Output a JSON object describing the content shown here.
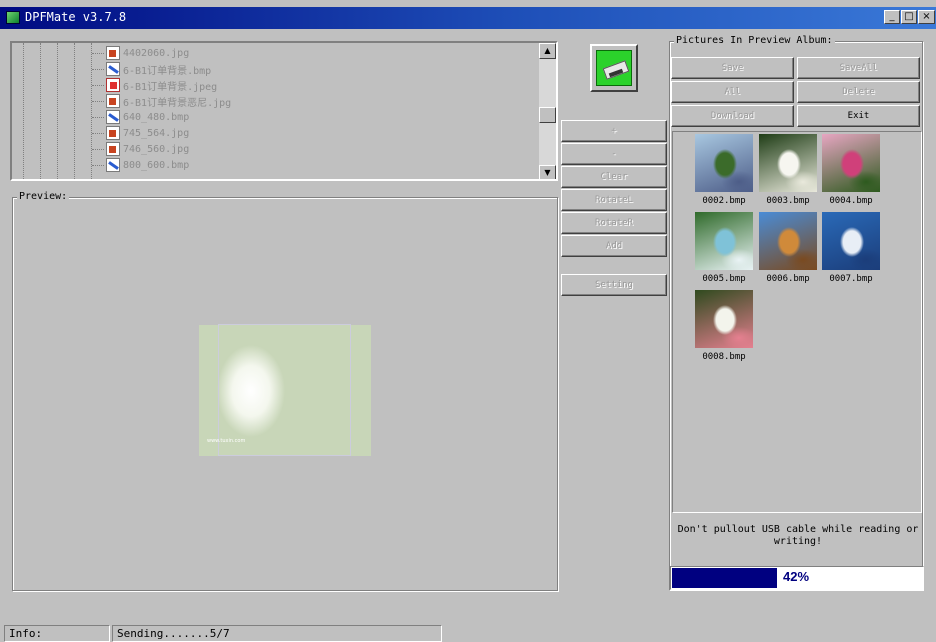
{
  "window": {
    "title": "DPFMate v3.7.8",
    "min_glyph": "_",
    "max_glyph": "□",
    "close_glyph": "×"
  },
  "file_tree": {
    "items": [
      {
        "name": "4402060.jpg",
        "type": "jpg"
      },
      {
        "name": "6-B1订单背景.bmp",
        "type": "bmp"
      },
      {
        "name": "6-B1订单背景.jpeg",
        "type": "jpeg"
      },
      {
        "name": "6-B1订单背景恶尼.jpg",
        "type": "jpg"
      },
      {
        "name": "640_480.bmp",
        "type": "bmp"
      },
      {
        "name": "745_564.jpg",
        "type": "jpg"
      },
      {
        "name": "746_560.jpg",
        "type": "jpg"
      },
      {
        "name": "800_600.bmp",
        "type": "bmp"
      }
    ]
  },
  "preview": {
    "title": "Preview:",
    "watermark": "www.tuxin.com"
  },
  "controls": {
    "zoom_in_label": "+",
    "zoom_out_label": "-",
    "clear_label": "Clear",
    "rotate_left_label": "RotateL",
    "rotate_right_label": "RotateR",
    "add_label": "Add",
    "setting_label": "Setting"
  },
  "album": {
    "title": "Pictures In Preview Album:",
    "save_label": "Save",
    "save_all_label": "SaveAll",
    "all_label": "All",
    "delete_label": "Delete",
    "download_label": "Download",
    "exit_label": "Exit",
    "thumbnails": [
      {
        "name": "0002.bmp",
        "colors": [
          "#a8c7e0",
          "#3b6b2a",
          "#4d5d88"
        ]
      },
      {
        "name": "0003.bmp",
        "colors": [
          "#1f3d16",
          "#f6f6f0",
          "#e9e9dc"
        ]
      },
      {
        "name": "0004.bmp",
        "colors": [
          "#e7a6c2",
          "#d0407a",
          "#2d5a1e"
        ]
      },
      {
        "name": "0005.bmp",
        "colors": [
          "#2f6a2a",
          "#7fc2d8",
          "#e9f3f5"
        ]
      },
      {
        "name": "0006.bmp",
        "colors": [
          "#4a8cd6",
          "#d08a3a",
          "#7a4a20"
        ]
      },
      {
        "name": "0007.bmp",
        "colors": [
          "#2a6ab8",
          "#e8eef6",
          "#1b3d7a"
        ]
      },
      {
        "name": "0008.bmp",
        "colors": [
          "#2f4a1e",
          "#f3f4ec",
          "#e58090"
        ]
      }
    ],
    "warning": "Don't pullout USB cable while reading or writing!",
    "progress": {
      "percent_text": "42%",
      "fraction": 0.42
    }
  },
  "status": {
    "label": "Info:",
    "message": "Sending.......5/7"
  }
}
